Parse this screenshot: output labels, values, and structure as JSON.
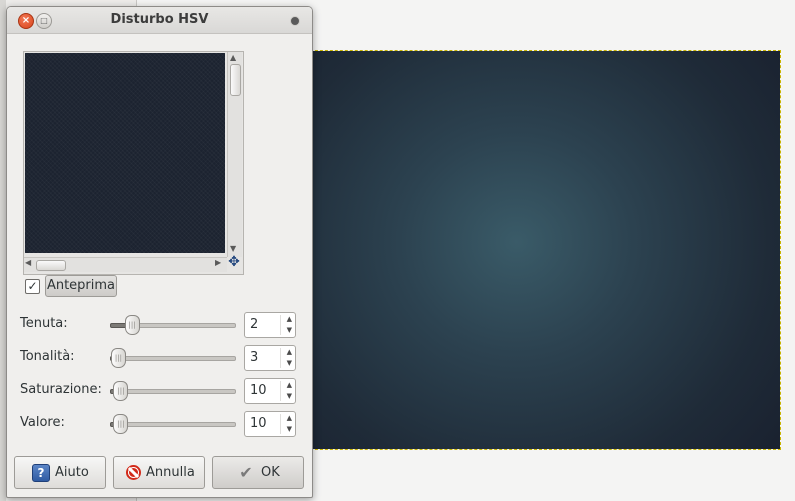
{
  "dialog": {
    "title": "Disturbo HSV",
    "close_glyph": "×",
    "maximize_glyph": "□"
  },
  "preview": {
    "toggle_label": "Anteprima",
    "checked": true,
    "check_glyph": "✓",
    "nav_glyph": "✥",
    "arrow_up": "▲",
    "arrow_down": "▼",
    "arrow_left": "◀",
    "arrow_right": "▶"
  },
  "params": [
    {
      "label": "Tenuta:",
      "value": "2",
      "fraction": 0.17
    },
    {
      "label": "Tonalità:",
      "value": "3",
      "fraction": 0.06
    },
    {
      "label": "Saturazione:",
      "value": "10",
      "fraction": 0.08
    },
    {
      "label": "Valore:",
      "value": "10",
      "fraction": 0.08
    }
  ],
  "spin_up": "▲",
  "spin_down": "▼",
  "buttons": {
    "help": "Aiuto",
    "help_glyph": "?",
    "cancel": "Annulla",
    "ok": "OK",
    "ok_glyph": "✔"
  },
  "colors": {
    "canvas_center": "#3a5b68",
    "canvas_edge": "#1a2230",
    "selection_border": "#c8b400"
  },
  "icons": [
    "close-icon",
    "maximize-icon",
    "menu-icon",
    "navigate-icon",
    "help-icon",
    "cancel-icon",
    "ok-check-icon"
  ]
}
